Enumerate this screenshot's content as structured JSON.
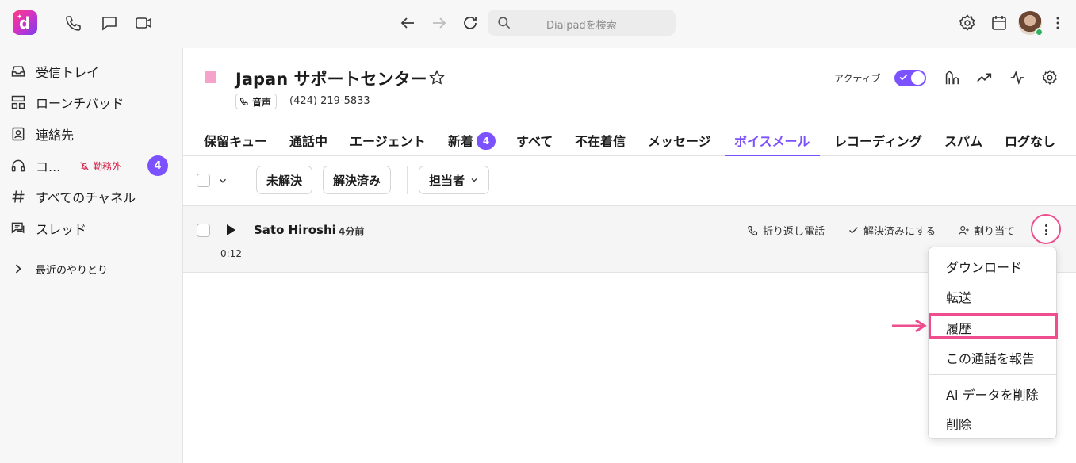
{
  "app": {
    "name": "Dialpad"
  },
  "search": {
    "placeholder": "Dialpadを検索"
  },
  "sidebar": {
    "items": [
      {
        "label": "受信トレイ",
        "icon": "inbox-icon"
      },
      {
        "label": "ローンチパッド",
        "icon": "launchpad-icon"
      },
      {
        "label": "連絡先",
        "icon": "contacts-icon"
      },
      {
        "label": "コ...",
        "icon": "headset-icon",
        "status": "勤務外",
        "badge": "4"
      },
      {
        "label": "すべてのチャネル",
        "icon": "hash-icon"
      },
      {
        "label": "スレッド",
        "icon": "threads-icon"
      },
      {
        "label": "最近のやりとり",
        "icon": "chevron-right-icon"
      }
    ]
  },
  "header": {
    "title": "Japan サポートセンター",
    "voice_label": "音声",
    "phone": "(424) 219-5833",
    "active_label": "アクティブ",
    "active_on": true,
    "color_square": "#f5a3cb"
  },
  "tabs": [
    {
      "label": "保留キュー"
    },
    {
      "label": "通話中"
    },
    {
      "label": "エージェント"
    },
    {
      "label": "新着",
      "badge": "4"
    },
    {
      "label": "すべて"
    },
    {
      "label": "不在着信"
    },
    {
      "label": "メッセージ"
    },
    {
      "label": "ボイスメール",
      "active": true
    },
    {
      "label": "レコーディング"
    },
    {
      "label": "スパム"
    },
    {
      "label": "ログなし"
    }
  ],
  "filters": {
    "unresolved": "未解決",
    "resolved": "解決済み",
    "assignee": "担当者"
  },
  "voicemail": {
    "caller": "Sato Hiroshi",
    "time_ago": "4分前",
    "duration": "0:12",
    "actions": {
      "call_back": "折り返し電話",
      "mark_resolved": "解決済みにする",
      "assign": "割り当て"
    }
  },
  "menu": {
    "items": [
      "ダウンロード",
      "転送",
      "履歴",
      "この通話を報告",
      "Ai データを削除",
      "削除"
    ],
    "highlighted": "履歴"
  },
  "colors": {
    "accent": "#7c52ff",
    "highlight": "#ee4d8e",
    "offline": "#d4234a"
  }
}
